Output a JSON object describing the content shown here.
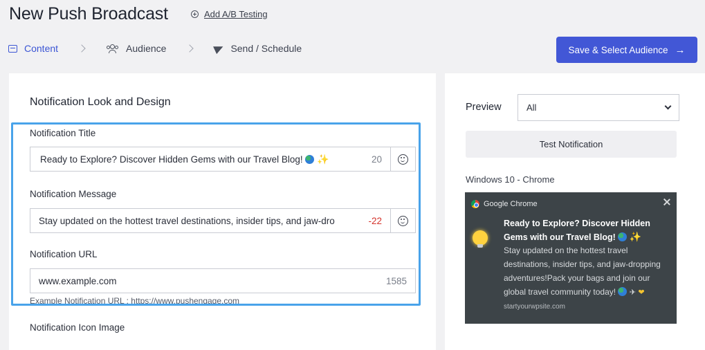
{
  "header": {
    "title": "New Push Broadcast",
    "ab_link": "Add A/B Testing"
  },
  "steps": [
    {
      "label": "Content",
      "icon": "content-icon",
      "active": true
    },
    {
      "label": "Audience",
      "icon": "audience-icon",
      "active": false
    },
    {
      "label": "Send / Schedule",
      "icon": "send-icon",
      "active": false
    }
  ],
  "save_button": {
    "label": "Save & Select Audience",
    "color": "#4257d6"
  },
  "form": {
    "section_title": "Notification Look and Design",
    "title_field": {
      "label": "Notification Title",
      "value": "Ready to Explore? Discover Hidden Gems with our Travel Blog!",
      "count": "20"
    },
    "message_field": {
      "label": "Notification Message",
      "value": "Stay updated on the hottest travel destinations, insider tips, and jaw-dro",
      "count": "-22"
    },
    "url_field": {
      "label": "Notification URL",
      "value": "www.example.com",
      "count": "1585",
      "hint": "Example Notification URL : https://www.pushengage.com"
    },
    "icon_image_label": "Notification Icon Image"
  },
  "preview": {
    "label": "Preview",
    "select_value": "All",
    "test_button": "Test Notification",
    "platform": "Windows 10 - Chrome",
    "notification": {
      "app_name": "Google Chrome",
      "title": "Ready to Explore? Discover Hidden Gems with our Travel Blog!",
      "message": "Stay updated on the hottest travel destinations, insider tips, and jaw-dropping adventures!Pack your bags and join our global travel community today!",
      "site": "startyourwpsite.com",
      "background": "#3d4448"
    }
  },
  "highlight_color": "#49a3ea"
}
